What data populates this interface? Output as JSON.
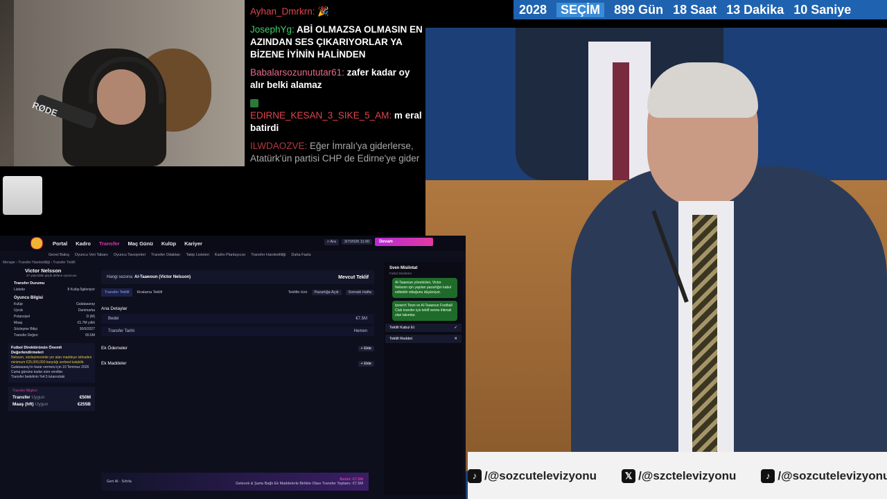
{
  "countdown": {
    "year": "2028",
    "label": "SEÇİM",
    "days": "899 Gün",
    "hours": "18 Saat",
    "minutes": "13 Dakika",
    "seconds": "10 Saniye"
  },
  "webcam": {
    "mic_brand": "RØDE"
  },
  "chat": [
    {
      "user": "Ayhan_Dmrkrn:",
      "text": "",
      "user_color": "#e0444e"
    },
    {
      "user": "JosephYg:",
      "text": "ABİ OLMAZSA OLMASIN EN AZINDAN SES ÇIKARIYORLAR YA BİZENE İYİNİN HALİNDEN",
      "user_color": "#3fcf6a"
    },
    {
      "user": "Babalarsozunututar61:",
      "text": "zafer kadar oy alır belki alamaz",
      "user_color": "#e86a8a"
    },
    {
      "user": "EDIRNE_KESAN_3_SIKE_5_AM:",
      "text": "m eral batirdi",
      "user_color": "#e0444e"
    },
    {
      "user": "ILWDAOZVE:",
      "text": "Eğer İmralı'ya giderlerse, Atatürk'ün partisi CHP de Edirne'ye gider",
      "user_color": "#e0444e"
    }
  ],
  "social": [
    "/@sozcutelevizyonu",
    "/@szctelevizyonu",
    "/@sozcutelevizyonu"
  ],
  "game": {
    "nav": [
      "Portal",
      "Kadro",
      "Transfer",
      "Maç Günü",
      "Kulüp",
      "Kariyer"
    ],
    "subnav": [
      "Genel Bakış",
      "Oyuncu Veri Tabanı",
      "Oyuncu Tavsiyeleri",
      "Transfer Odakları",
      "Takip Listeleri",
      "Kadro Planlayıcısı",
      "Transfer Hareketliliği",
      "Daha Fazla"
    ],
    "search": "Ara",
    "date": "3/7/2026",
    "time": "11:00",
    "continue": "Devam",
    "crumb": "Menajer › Transfer Hareketliliği › Transfer Teklifi",
    "player": {
      "name": "Victor Nelsson",
      "sub": "27 yaşındaki güçlü defans oyuncusu"
    },
    "status_title": "Transfer Durumu",
    "status_list": "Listede",
    "status_clubs": "8 Kulüp İlgileniyor",
    "info_title": "Oyuncu Bilgisi",
    "info": [
      {
        "k": "Kulüp",
        "v": "Galatasaray"
      },
      {
        "k": "Uyruk",
        "v": "Danimarka"
      },
      {
        "k": "Potansiyel",
        "v": "D (M)"
      },
      {
        "k": "Maaş",
        "v": "€1.7M yıllık"
      },
      {
        "k": "Sözleşme Bitişi",
        "v": "30/6/2027"
      },
      {
        "k": "Transfer Değeri",
        "v": "€6.6M"
      }
    ],
    "advice_title": "Futbol Direktörünün Önemli Değerlendirmeleri",
    "advice": [
      "Nelsson, sözleşmesinde yer alan maddeye istinaden minimum €25,000,000 karşılığı serbest kalabilir.",
      "Galatasaray'ın karar vermesi için 10 Temmuz 2026 Cuma gününe kadar süre verdiler.",
      "Transfer bedelinin %4.5 tutarındaki"
    ],
    "fee_title": "Transfer Bilgileri",
    "fee_rows": [
      {
        "k": "Transfer",
        "s": "Uygun",
        "v": "€50M"
      },
      {
        "k": "Maaş (hft)",
        "s": "Uygun",
        "v": "€255B"
      }
    ],
    "season_label": "Hangi sezona:",
    "season_value": "Al-Taawoun (Victor Nelsson)",
    "offer_title": "Mevcut Teklif",
    "tab1": "Transfer Teklifi",
    "tab2": "Kiralama Teklifi",
    "terms_label": "Teklifin türü",
    "negotiation": "Pazarlığa Açık",
    "future": "Sonraki Hafta",
    "main_title": "Ana Detaylar",
    "fee_label": "Bedel",
    "fee_value": "€7.5M",
    "date_label": "Transfer Tarihi",
    "date_value": "Hemen",
    "extra_pay": "Ek Ödemeler",
    "extra_clauses": "Ek Maddeler",
    "add": "Ekle",
    "bottom_left1": "Geri Al",
    "bottom_left2": "Sıfırla",
    "bottom_fee": "Bedel: €7.5M",
    "bottom_total": "Gelecek & Şarta Bağlı Ek Maddelerle Birlikte Olası Transfer Toplamı: €7.5M",
    "director_name": "Sven Mislintat",
    "director_role": "Futbol Direktörü",
    "bubble1": "Al-Taawoun yöneticileri, Victor Nelsson için yapılan pazarlığın kabul edilebilir olduğunu düşünüyor.",
    "bubble2": "Ipswich Town ve Al-Taawoun Football Club transfer için teklif verme ihtimali olan takımlar.",
    "accept": "Teklifi Kabul Et",
    "reject": "Teklifi Reddet"
  }
}
